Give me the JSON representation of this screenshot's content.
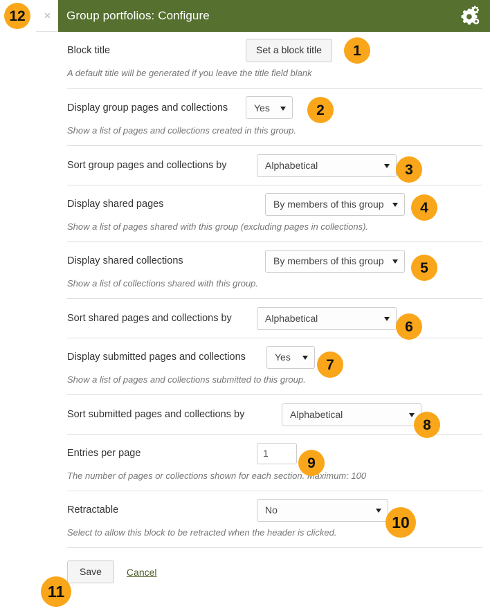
{
  "window": {
    "title": "Group portfolios: Configure",
    "close_label": "×",
    "settings_icon": "cogs-icon",
    "header_color": "#55702f",
    "badge_color": "#faa61a"
  },
  "markers": {
    "m1": "1",
    "m2": "2",
    "m3": "3",
    "m4": "4",
    "m5": "5",
    "m6": "6",
    "m7": "7",
    "m8": "8",
    "m9": "9",
    "m10": "10",
    "m11": "11",
    "m12": "12"
  },
  "fields": {
    "block_title": {
      "label": "Block title",
      "button_label": "Set a block title",
      "help": "A default title will be generated if you leave the title field blank"
    },
    "display_group_pages": {
      "label": "Display group pages and collections",
      "value": "Yes",
      "help": "Show a list of pages and collections created in this group."
    },
    "sort_group_pages": {
      "label": "Sort group pages and collections by",
      "value": "Alphabetical",
      "help": ""
    },
    "display_shared_pages": {
      "label": "Display shared pages",
      "value": "By members of this group",
      "help": "Show a list of pages shared with this group (excluding pages in collections)."
    },
    "display_shared_collections": {
      "label": "Display shared collections",
      "value": "By members of this group",
      "help": "Show a list of collections shared with this group."
    },
    "sort_shared_pages": {
      "label": "Sort shared pages and collections by",
      "value": "Alphabetical",
      "help": ""
    },
    "display_submitted_pages": {
      "label": "Display submitted pages and collections",
      "value": "Yes",
      "help": "Show a list of pages and collections submitted to this group."
    },
    "sort_submitted_pages": {
      "label": "Sort submitted pages and collections by",
      "value": "Alphabetical",
      "help": ""
    },
    "entries_per_page": {
      "label": "Entries per page",
      "value": "1",
      "help": "The number of pages or collections shown for each section. Maximum: 100"
    },
    "retractable": {
      "label": "Retractable",
      "value": "No",
      "help": "Select to allow this block to be retracted when the header is clicked."
    }
  },
  "actions": {
    "save_label": "Save",
    "cancel_label": "Cancel"
  }
}
